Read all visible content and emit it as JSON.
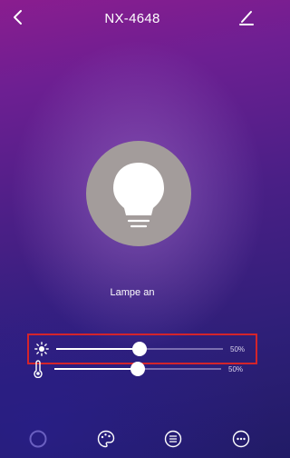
{
  "header": {
    "title": "NX-4648"
  },
  "lamp": {
    "status": "Lampe an"
  },
  "sliders": {
    "brightness": {
      "value_percent": 50,
      "label": "50%"
    },
    "temperature": {
      "value_percent": 50,
      "label": "50%"
    }
  },
  "icons": {
    "back": "chevron-left-icon",
    "edit": "pencil-icon",
    "bulb": "light-bulb-icon",
    "brightness": "sun-icon",
    "temperature": "thermometer-icon",
    "tabs": [
      "power-ring-icon",
      "palette-icon",
      "list-icon",
      "more-dots-icon"
    ]
  },
  "colors": {
    "highlight_border": "#d4242b",
    "bulb_circle": "#a39c9b"
  }
}
